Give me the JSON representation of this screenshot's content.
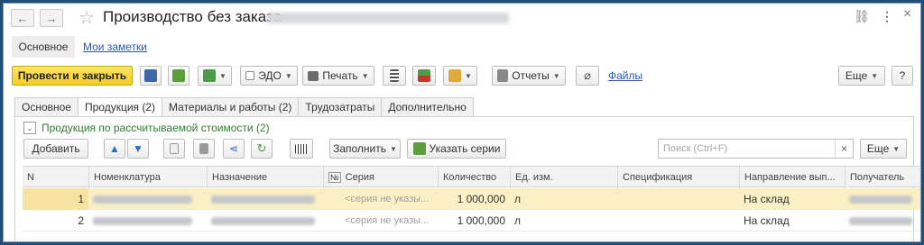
{
  "window": {
    "title": "Производство без заказа",
    "back_icon": "←",
    "forward_icon": "→",
    "star_icon": "☆",
    "link_icon": "⛓",
    "more_icon": "⋮",
    "close_icon": "×"
  },
  "sections": {
    "main": "Основное",
    "notes": "Мои заметки"
  },
  "toolbar": {
    "post_close": "Провести и закрыть",
    "edo": "ЭДО",
    "print": "Печать",
    "reports": "Отчеты",
    "files": "Файлы",
    "more": "Еще",
    "help": "?"
  },
  "tabs": [
    "Основное",
    "Продукция (2)",
    "Материалы и работы (2)",
    "Трудозатраты",
    "Дополнительно"
  ],
  "group": {
    "collapse_icon": "⌄",
    "title": "Продукция по рассчитываемой стоимости (2)"
  },
  "table_toolbar": {
    "add": "Добавить",
    "fill": "Заполнить",
    "series": "Указать серии",
    "search_placeholder": "Поиск (Ctrl+F)",
    "search_clear": "×",
    "more": "Еще"
  },
  "columns": {
    "n": "N",
    "nomenclature": "Номенклатура",
    "purpose": "Назначение",
    "no_sign": "№",
    "series": "Серия",
    "quantity": "Количество",
    "unit": "Ед. изм.",
    "spec": "Спецификация",
    "direction": "Направление вып...",
    "receiver": "Получатель"
  },
  "rows": [
    {
      "n": "1",
      "series": "<серия не указы...",
      "quantity": "1 000,000",
      "unit": "л",
      "direction": "На склад"
    },
    {
      "n": "2",
      "series": "<серия не указы...",
      "quantity": "1 000,000",
      "unit": "л",
      "direction": "На склад"
    }
  ],
  "colors": {
    "primary_button": "#f5cc1f",
    "link": "#2a59a8",
    "group_title": "#2f7d32",
    "selected_row": "#fbf0c5"
  }
}
